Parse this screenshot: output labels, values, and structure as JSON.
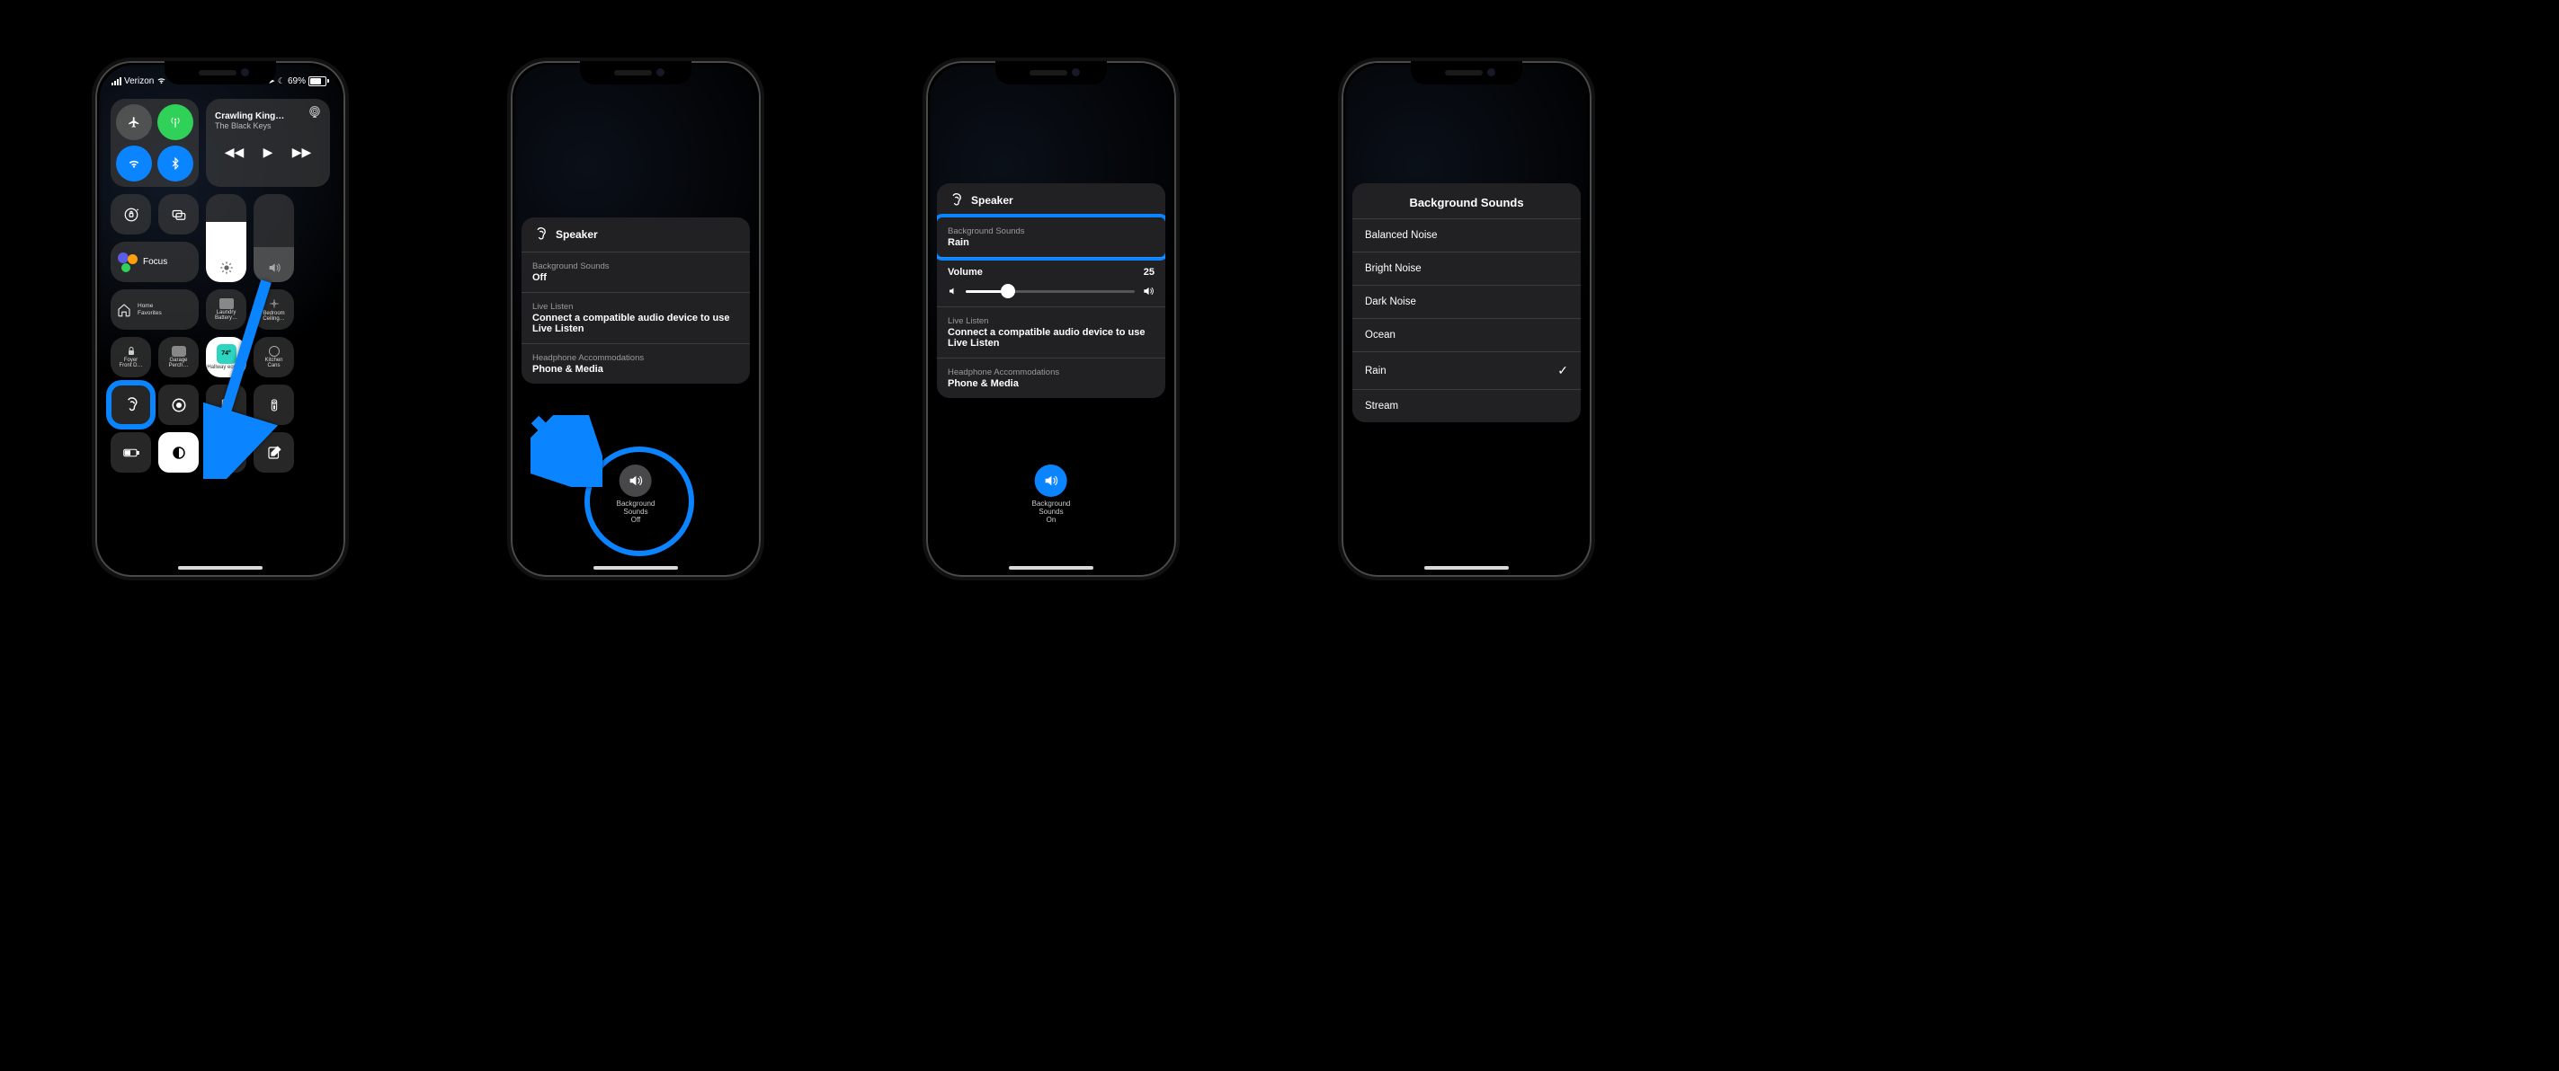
{
  "phone1": {
    "status": {
      "carrier": "Verizon",
      "battery_pct": "69%",
      "location_glyph": "➤",
      "focus_glyph": "☾"
    },
    "media": {
      "title": "Crawling King…",
      "artist": "The Black Keys"
    },
    "focus_label": "Focus",
    "brightness_pct": 68,
    "volume_pct": 40,
    "home_tiles": {
      "favorites_label": "Home\nFavorites",
      "laundry": "Laundry\nBattery…",
      "bedroom": "Bedroom\nCeiling…",
      "foyer": "Foyer\nFront D…",
      "garage": "Garage\nPerch…",
      "hallway": "Hallway\necobee",
      "hallway_temp": "74°",
      "kitchen": "Kitchen\nCans"
    }
  },
  "phone2": {
    "header": "Speaker",
    "rows": {
      "bg_label": "Background Sounds",
      "bg_value": "Off",
      "live_label": "Live Listen",
      "live_value": "Connect a compatible audio device to use Live Listen",
      "headphone_label": "Headphone Accommodations",
      "headphone_value": "Phone & Media"
    },
    "button": {
      "l1": "Background",
      "l2": "Sounds",
      "l3": "Off"
    }
  },
  "phone3": {
    "header": "Speaker",
    "rows": {
      "bg_label": "Background Sounds",
      "bg_value": "Rain",
      "vol_label": "Volume",
      "vol_value": "25",
      "vol_pct": 25,
      "live_label": "Live Listen",
      "live_value": "Connect a compatible audio device to use Live Listen",
      "headphone_label": "Headphone Accommodations",
      "headphone_value": "Phone & Media"
    },
    "button": {
      "l1": "Background",
      "l2": "Sounds",
      "l3": "On"
    }
  },
  "phone4": {
    "title": "Background Sounds",
    "options": [
      "Balanced Noise",
      "Bright Noise",
      "Dark Noise",
      "Ocean",
      "Rain",
      "Stream"
    ],
    "selected_index": 4
  }
}
